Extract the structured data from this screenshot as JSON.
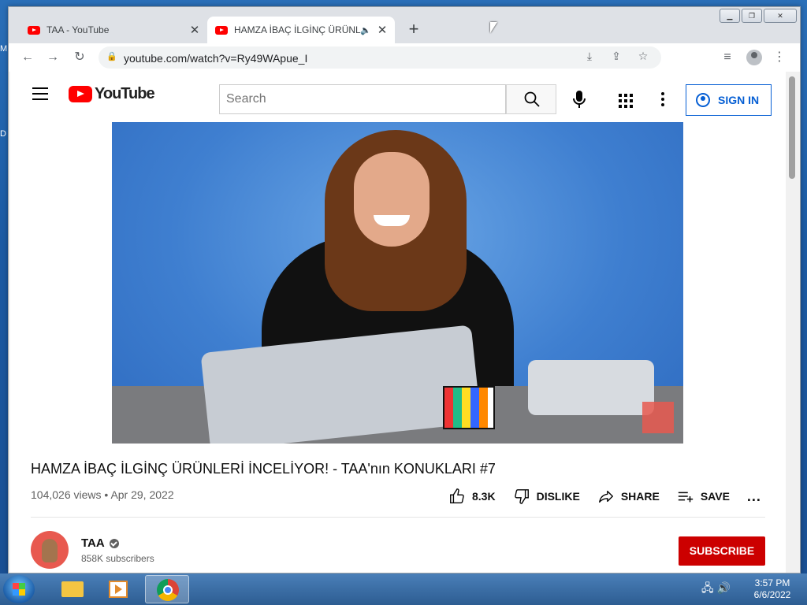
{
  "desktop": {
    "edge_text_1": "M",
    "edge_text_2": "D"
  },
  "browser": {
    "tabs": [
      {
        "title": "TAA - YouTube",
        "active": false
      },
      {
        "title": "HAMZA İBAÇ İLGİNÇ ÜRÜNLERİ İNCELİYOR! - TAA'nın KONUKLARI #7",
        "active": true,
        "audio": true
      }
    ],
    "new_tab_label": "+",
    "url": "youtube.com/watch?v=Ry49WApue_I"
  },
  "youtube": {
    "logo_text": "YouTube",
    "search_placeholder": "Search",
    "sign_in_label": "SIGN IN",
    "video": {
      "title": "HAMZA İBAÇ İLGİNÇ ÜRÜNLERİ İNCELİYOR! - TAA'nın KONUKLARI #7",
      "views": "104,026 views",
      "date": "Apr 29, 2022",
      "like_count": "8.3K",
      "dislike_label": "DISLIKE",
      "share_label": "SHARE",
      "save_label": "SAVE",
      "more_label": "..."
    },
    "channel": {
      "name": "TAA",
      "subscribers": "858K subscribers",
      "subscribe_label": "SUBSCRIBE"
    }
  },
  "taskbar": {
    "time": "3:57 PM",
    "date": "6/6/2022"
  },
  "colors": {
    "yt_red": "#ff0000",
    "link_blue": "#065fd4",
    "subscribe_red": "#cc0000"
  }
}
